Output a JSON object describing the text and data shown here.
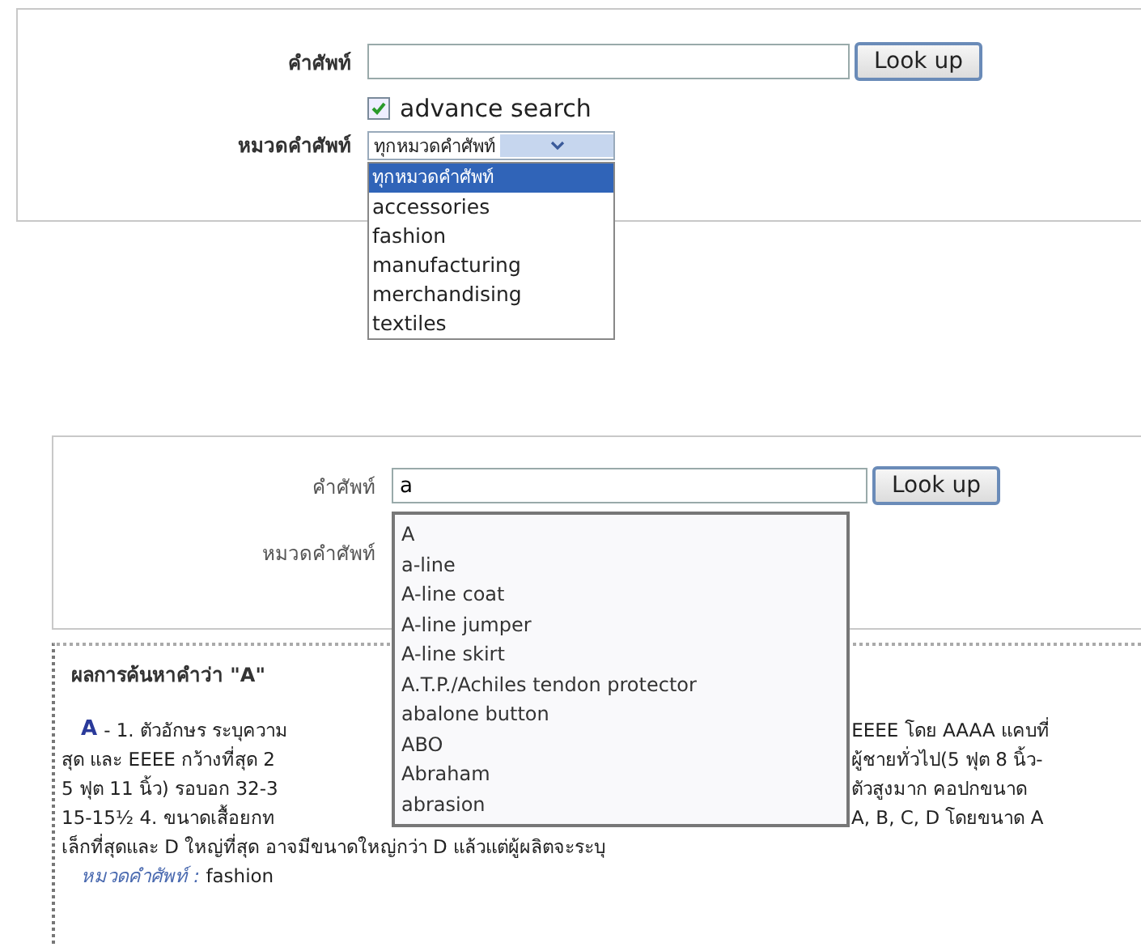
{
  "search_form_1": {
    "term_label": "คำศัพท์",
    "button": "Look up",
    "advance_search": {
      "label": "advance search",
      "checked": true
    },
    "category_label": "หมวดคำศัพท์",
    "category_value": "ทุกหมวดคำศัพท์",
    "category_options": [
      {
        "label": "ทุกหมวดคำศัพท์",
        "selected": true
      },
      {
        "label": "accessories",
        "selected": false
      },
      {
        "label": "fashion",
        "selected": false
      },
      {
        "label": "manufacturing",
        "selected": false
      },
      {
        "label": "merchandising",
        "selected": false
      },
      {
        "label": "textiles",
        "selected": false
      }
    ]
  },
  "search_form_2": {
    "term_label": "คำศัพท์",
    "term_value": "a",
    "button": "Look up",
    "category_label": "หมวดคำศัพท์",
    "suggestions": [
      "A",
      "a-line",
      "A-line coat",
      "A-line jumper",
      "A-line skirt",
      "A.T.P./Achiles tendon protector",
      "abalone button",
      "ABO",
      "Abraham",
      "abrasion"
    ]
  },
  "result": {
    "heading": "ผลการค้นหาคำว่า \"A\"",
    "entry_term": "A",
    "lines": [
      {
        "left": "- 1. ตัวอักษร ระบุความ",
        "right": "EEEE โดย AAAA แคบที่"
      },
      {
        "left": "สุด และ EEEE กว้างที่สุด 2",
        "right": "ผู้ชายทั่วไป(5 ฟุต 8 นิ้ว-"
      },
      {
        "left": "5 ฟุต 11 นิ้ว) รอบอก 32-3",
        "right": "ตัวสูงมาก คอปกขนาด"
      },
      {
        "left": "15-15½ 4. ขนาดเสื้อยกท",
        "right": "A, B, C, D โดยขนาด A"
      },
      {
        "left": "เล็กที่สุดและ D ใหญ่ที่สุด อาจมีขนาดใหญ่กว่า D แล้วแต่ผู้ผลิตจะระบุ"
      }
    ],
    "category_label": "หมวดคำศัพท์ :",
    "category_value": "fashion"
  }
}
